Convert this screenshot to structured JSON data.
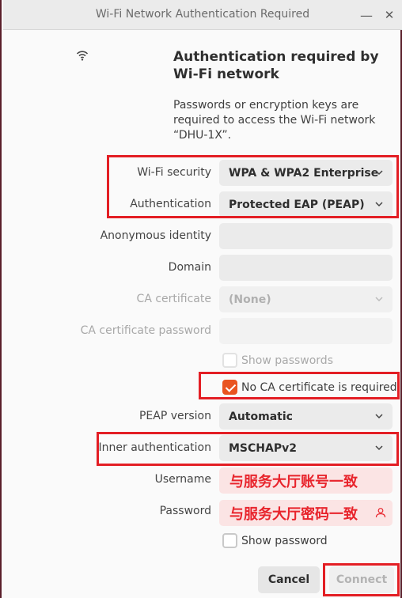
{
  "window": {
    "title": "Wi-Fi Network Authentication Required",
    "minimize_glyph": "—",
    "close_glyph": "✕"
  },
  "header": {
    "icon": "wifi-icon",
    "heading": "Authentication required by Wi-Fi network",
    "description": "Passwords or encryption keys are required to access the Wi-Fi network “DHU-1X”."
  },
  "form": {
    "wifi_security": {
      "label": "Wi-Fi security",
      "value": "WPA & WPA2 Enterprise"
    },
    "authentication": {
      "label": "Authentication",
      "value": "Protected EAP (PEAP)"
    },
    "anonymous_identity": {
      "label": "Anonymous identity",
      "value": ""
    },
    "domain": {
      "label": "Domain",
      "value": ""
    },
    "ca_certificate": {
      "label": "CA certificate",
      "value": "(None)"
    },
    "ca_certificate_password": {
      "label": "CA certificate password",
      "value": ""
    },
    "show_passwords": {
      "label": "Show passwords",
      "checked": false
    },
    "no_ca_required": {
      "label": "No CA certificate is required",
      "checked": true
    },
    "peap_version": {
      "label": "PEAP version",
      "value": "Automatic"
    },
    "inner_authentication": {
      "label": "Inner authentication",
      "value": "MSCHAPv2"
    },
    "username": {
      "label": "Username",
      "value": "与服务大厅账号一致"
    },
    "password": {
      "label": "Password",
      "value": "与服务大厅密码一致"
    },
    "show_password": {
      "label": "Show password",
      "checked": false
    }
  },
  "buttons": {
    "cancel": "Cancel",
    "connect": "Connect"
  },
  "colors": {
    "accent": "#e95420",
    "highlight": "#e31e24",
    "annotation_text": "#e8242c"
  }
}
